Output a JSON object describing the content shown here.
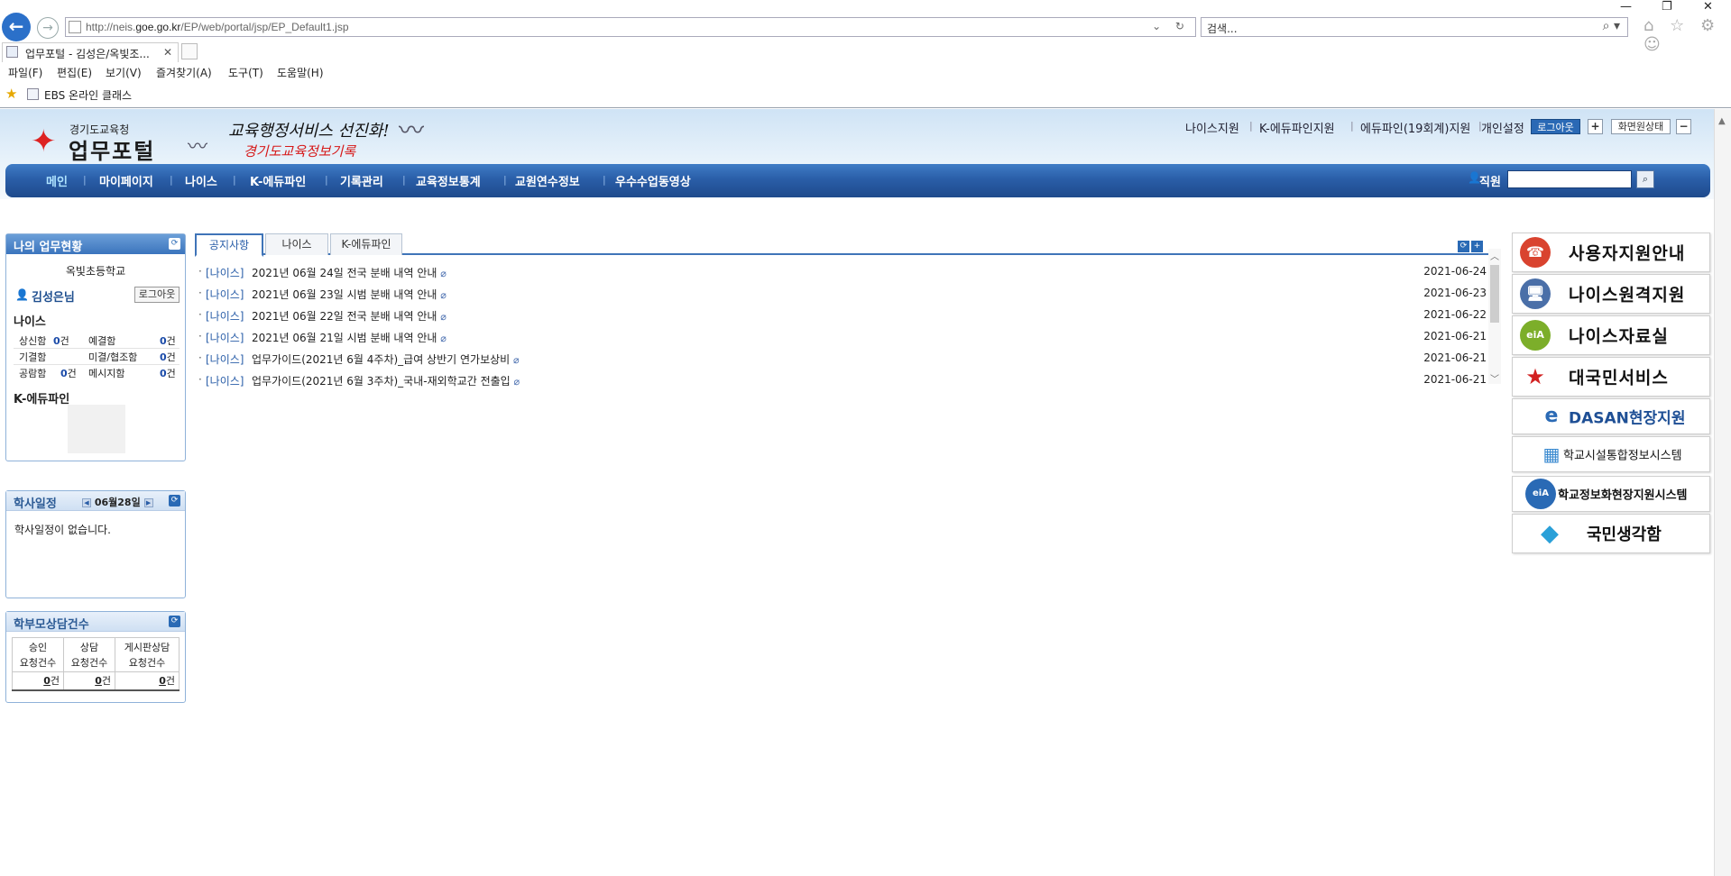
{
  "browser": {
    "window_controls": [
      "—",
      "❐",
      "✕"
    ],
    "url_host_prefix": "http://neis.",
    "url_host": "goe.go.kr",
    "url_path": "/EP/web/portal/jsp/EP_Default1.jsp",
    "address_tools": "⌄ ↻",
    "search_placeholder": "검색...",
    "search_icon": "⌕ ▾",
    "right_icons": "⌂ ☆ ⚙ ☺",
    "tab_title": "업무포털 - 김성은/옥빛조...",
    "tab_close": "✕",
    "menus": [
      "파일(F)",
      "편집(E)",
      "보기(V)",
      "즐겨찾기(A)",
      "도구(T)",
      "도움말(H)"
    ],
    "favorites_bar": [
      "EBS 온라인 클래스"
    ]
  },
  "header": {
    "logo_sub": "경기도교육청",
    "logo_main": "업무포털",
    "slogan_line1": "교육행정서비스 선진화!",
    "slogan_line2": "경기도교육정보기록",
    "top_links": [
      "나이스지원",
      "K-에듀파인지원",
      "에듀파인(19회계)지원",
      "개인설정"
    ],
    "logout_label": "로그아웃",
    "plus_label": "+",
    "screen_state_label": "화면원상태",
    "minus_label": "−"
  },
  "gnb": {
    "items": [
      "메인",
      "마이페이지",
      "나이스",
      "K-에듀파인",
      "기록관리",
      "교육정보통계",
      "교원연수정보",
      "우수수업동영상"
    ],
    "active_index": 0,
    "staff_label": "직원",
    "search_button": "🔍"
  },
  "work_panel": {
    "title": "나의 업무현황",
    "school": "옥빛초등학교",
    "user": "김성은님",
    "logout": "로그아웃",
    "neis_title": "나이스",
    "stats": [
      {
        "label": "상신함",
        "count": "0",
        "unit": "건"
      },
      {
        "label": "예결함",
        "count": "0",
        "unit": "건"
      },
      {
        "label": "기결함",
        "count": "",
        "unit": ""
      },
      {
        "label": "미결/협조함",
        "count": "0",
        "unit": "건"
      },
      {
        "label": "공람함",
        "count": "0",
        "unit": "건"
      },
      {
        "label": "메시지함",
        "count": "0",
        "unit": "건"
      }
    ],
    "kedufine_title": "K-에듀파인"
  },
  "calendar_panel": {
    "title": "학사일정",
    "date": "06월28일",
    "prev": "◀",
    "next": "▶",
    "empty_text": "학사일정이 없습니다."
  },
  "parent_panel": {
    "title": "학부모상담건수",
    "headers": [
      [
        "승인",
        "요청건수"
      ],
      [
        "상담",
        "요청건수"
      ],
      [
        "게시판상담",
        "요청건수"
      ]
    ],
    "counts": [
      "0",
      "0",
      "0"
    ],
    "unit": "건"
  },
  "notice_tabs": [
    "공지사항",
    "나이스",
    "K-에듀파인"
  ],
  "notices": [
    {
      "category": "[나이스]",
      "title": "2021년 06월 24일 전국 분배 내역 안내",
      "date": "2021-06-24"
    },
    {
      "category": "[나이스]",
      "title": "2021년 06월 23일 시범 분배 내역 안내",
      "date": "2021-06-23"
    },
    {
      "category": "[나이스]",
      "title": "2021년 06월 22일 전국 분배 내역 안내",
      "date": "2021-06-22"
    },
    {
      "category": "[나이스]",
      "title": "2021년 06월 21일 시범 분배 내역 안내",
      "date": "2021-06-21"
    },
    {
      "category": "[나이스]",
      "title": "업무가이드(2021년 6월 4주차)_급여 상반기 연가보상비",
      "date": "2021-06-21"
    },
    {
      "category": "[나이스]",
      "title": "업무가이드(2021년 6월 3주차)_국내-재외학교간 전출입",
      "date": "2021-06-21"
    }
  ],
  "banners": [
    {
      "label": "사용자지원안내",
      "icon": "☎",
      "color": "#d9432f"
    },
    {
      "label": "나이스원격지원",
      "icon": "🖥",
      "color": "#4a6fa8"
    },
    {
      "label": "나이스자료실",
      "icon": "eiA",
      "color": "#7cae2a"
    },
    {
      "label": "대국민서비스",
      "icon": "★",
      "color": "#d22222"
    },
    {
      "label": "DASAN현장지원",
      "icon": "e",
      "color": "#2a6ab5"
    },
    {
      "label": "학교시설통합정보시스템",
      "icon": "▦",
      "color": "#3a8ad0"
    },
    {
      "label": "학교정보화현장지원시스템",
      "icon": "eiA",
      "color": "#2a6ab5"
    },
    {
      "label": "국민생각함",
      "icon": "◆",
      "color": "#2aa0d8"
    }
  ]
}
